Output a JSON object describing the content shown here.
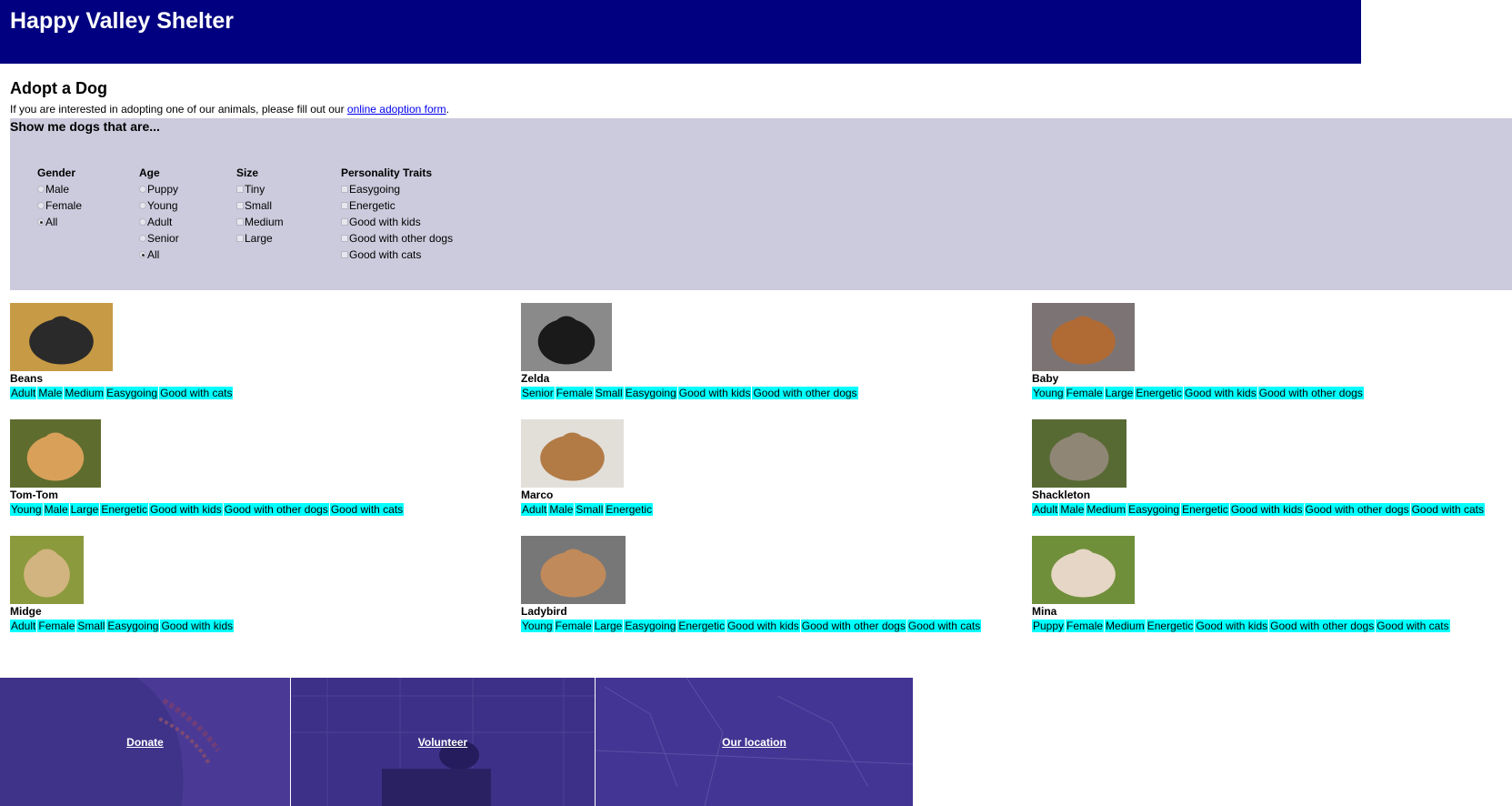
{
  "site": {
    "title": "Happy Valley Shelter"
  },
  "page": {
    "heading": "Adopt a Dog",
    "intro_before": "If you are interested in adopting one of our animals, please fill out our ",
    "intro_link": "online adoption form",
    "intro_after": "."
  },
  "filters": {
    "heading": "Show me dogs that are...",
    "gender": {
      "label": "Gender",
      "options": [
        "Male",
        "Female",
        "All"
      ],
      "selected": "All"
    },
    "age": {
      "label": "Age",
      "options": [
        "Puppy",
        "Young",
        "Adult",
        "Senior",
        "All"
      ],
      "selected": "All"
    },
    "size": {
      "label": "Size",
      "options": [
        "Tiny",
        "Small",
        "Medium",
        "Large"
      ]
    },
    "traits": {
      "label": "Personality Traits",
      "options": [
        "Easygoing",
        "Energetic",
        "Good with kids",
        "Good with other dogs",
        "Good with cats"
      ]
    }
  },
  "dogs": [
    {
      "name": "Beans",
      "tags": [
        "Adult",
        "Male",
        "Medium",
        "Easygoing",
        "Good with cats"
      ]
    },
    {
      "name": "Zelda",
      "tags": [
        "Senior",
        "Female",
        "Small",
        "Easygoing",
        "Good with kids",
        "Good with other dogs"
      ]
    },
    {
      "name": "Baby",
      "tags": [
        "Young",
        "Female",
        "Large",
        "Energetic",
        "Good with kids",
        "Good with other dogs"
      ]
    },
    {
      "name": "Tom-Tom",
      "tags": [
        "Young",
        "Male",
        "Large",
        "Energetic",
        "Good with kids",
        "Good with other dogs",
        "Good with cats"
      ]
    },
    {
      "name": "Marco",
      "tags": [
        "Adult",
        "Male",
        "Small",
        "Energetic"
      ]
    },
    {
      "name": "Shackleton",
      "tags": [
        "Adult",
        "Male",
        "Medium",
        "Easygoing",
        "Energetic",
        "Good with kids",
        "Good with other dogs",
        "Good with cats"
      ]
    },
    {
      "name": "Midge",
      "tags": [
        "Adult",
        "Female",
        "Small",
        "Easygoing",
        "Good with kids"
      ]
    },
    {
      "name": "Ladybird",
      "tags": [
        "Young",
        "Female",
        "Large",
        "Easygoing",
        "Energetic",
        "Good with kids",
        "Good with other dogs",
        "Good with cats"
      ]
    },
    {
      "name": "Mina",
      "tags": [
        "Puppy",
        "Female",
        "Medium",
        "Energetic",
        "Good with kids",
        "Good with other dogs",
        "Good with cats"
      ]
    }
  ],
  "footer": {
    "donate": "Donate",
    "volunteer": "Volunteer",
    "location": "Our location"
  },
  "colors": {
    "header_bg": "#000080",
    "filter_bg": "#cccbdd",
    "tag_bg": "#00ffff",
    "footer_bg": "#3e2f8c"
  }
}
